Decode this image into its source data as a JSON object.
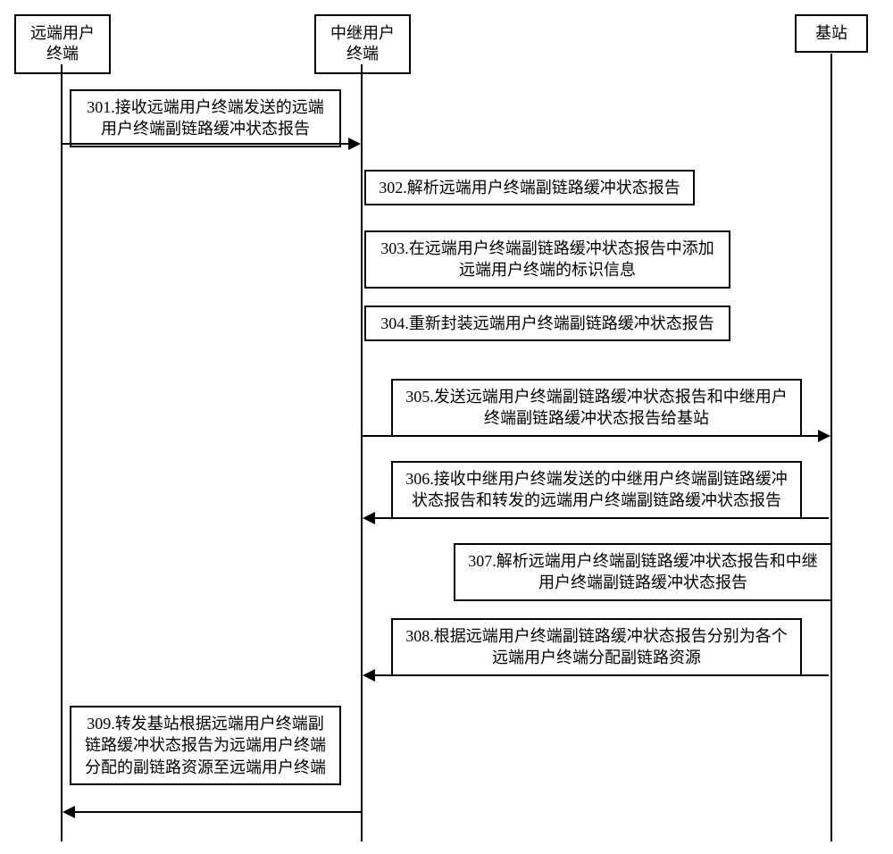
{
  "actors": {
    "remote": "远端用户\n终端",
    "relay": "中继用户\n终端",
    "base": "基站"
  },
  "steps": {
    "s301": "301.接收远端用户终端发送的远端用户终端副链路缓冲状态报告",
    "s302": "302.解析远端用户终端副链路缓冲状态报告",
    "s303": "303.在远端用户终端副链路缓冲状态报告中添加远端用户终端的标识信息",
    "s304": "304.重新封装远端用户终端副链路缓冲状态报告",
    "s305": "305.发送远端用户终端副链路缓冲状态报告和中继用户终端副链路缓冲状态报告给基站",
    "s306": "306.接收中继用户终端发送的中继用户终端副链路缓冲状态报告和转发的远端用户终端副链路缓冲状态报告",
    "s307": "307.解析远端用户终端副链路缓冲状态报告和中继用户终端副链路缓冲状态报告",
    "s308": "308.根据远端用户终端副链路缓冲状态报告分别为各个远端用户终端分配副链路资源",
    "s309": "309.转发基站根据远端用户终端副链路缓冲状态报告为远端用户终端分配的副链路资源至远端用户终端"
  }
}
